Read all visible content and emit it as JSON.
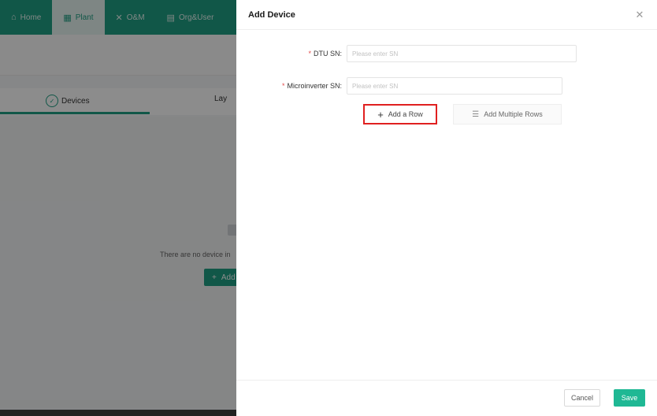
{
  "background_app": {
    "nav": [
      {
        "icon": "home-icon",
        "glyph": "⌂",
        "label": "Home",
        "active": false
      },
      {
        "icon": "plant-icon",
        "glyph": "▦",
        "label": "Plant",
        "active": true
      },
      {
        "icon": "o-and-m-icon",
        "glyph": "✕",
        "label": "O&M",
        "active": false
      },
      {
        "icon": "org-user-icon",
        "glyph": "▤",
        "label": "Org&User",
        "active": false
      }
    ],
    "tab_devices": "Devices",
    "tab_partial": "Lay",
    "empty_text": "There are no device in",
    "add_button_partial": "Add"
  },
  "drawer": {
    "title": "Add Device",
    "close_glyph": "✕",
    "dtu_label": "DTU SN:",
    "dtu_placeholder": "Please enter SN",
    "dtu_value": "",
    "micro_label": "Microinverter SN:",
    "micro_placeholder": "Please enter SN",
    "micro_value": "",
    "add_row_label": "Add a Row",
    "add_multiple_label": "Add Multiple Rows",
    "cancel_label": "Cancel",
    "save_label": "Save"
  },
  "colors": {
    "brand": "#1f9e83",
    "save": "#1fb894",
    "highlight": "#e02020",
    "required": "#e24b4b"
  }
}
